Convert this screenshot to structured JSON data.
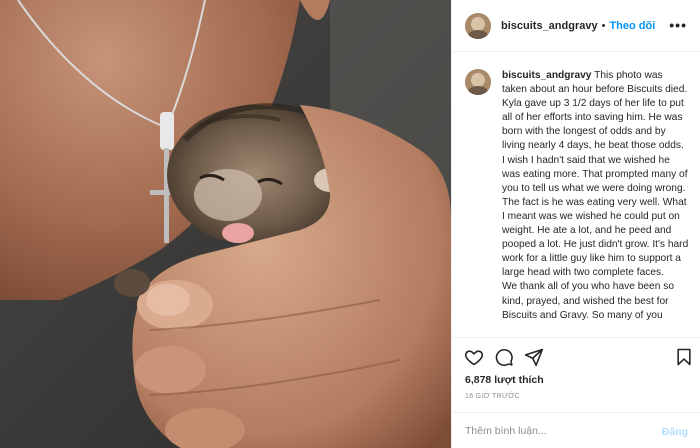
{
  "post": {
    "username": "biscuits_andgravy",
    "follow_label": "Theo dõi",
    "header_separator": "•",
    "more_label": "•••"
  },
  "caption": {
    "username": "biscuits_andgravy",
    "text": "This photo was taken about an hour before Biscuits died. Kyla gave up 3 1/2 days of her life to put all of her efforts into saving him. He was born with the longest of odds and by living nearly 4 days, he beat those odds. I wish I hadn't said that we wished he was eating more. That prompted many of you to tell us what we were doing wrong. The fact is he was eating very well. What I meant was we wished he could put on weight. He ate a lot, and he peed and pooped a lot. He just didn't grow. It's hard work for a little guy like him to support a large head with two complete faces.",
    "text2": "We thank all of you who have been so kind, prayed, and wished the best for Biscuits and Gravy. So many of you"
  },
  "actions": {
    "like_icon": "heart-icon",
    "comment_icon": "comment-icon",
    "share_icon": "share-icon",
    "save_icon": "bookmark-icon"
  },
  "likes": "6,878 lượt thích",
  "timestamp": "16 GIỜ TRƯỚC",
  "comment_box": {
    "placeholder": "Thêm bình luận...",
    "post_label": "Đăng"
  },
  "colors": {
    "accent": "#0095f6",
    "post_disabled": "#b2dffc",
    "muted": "#8e8e8e",
    "text": "#262626",
    "divider": "#efefef"
  }
}
